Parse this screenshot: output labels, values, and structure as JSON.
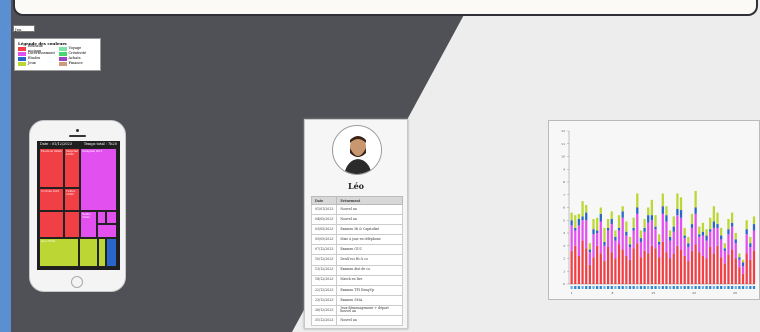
{
  "select": {
    "value": "Jeu"
  },
  "legend": {
    "title": "Légende des couleurs",
    "items": [
      {
        "label": "Réseaux sociaux",
        "color": "#f03f45"
      },
      {
        "label": "Voyage",
        "color": "#7fe2a6"
      },
      {
        "label": "Divertissement",
        "color": "#e350f0"
      },
      {
        "label": "Créativité",
        "color": "#46d66b"
      },
      {
        "label": "Etudes",
        "color": "#2a65c9"
      },
      {
        "label": "Achats",
        "color": "#9a45c9"
      },
      {
        "label": "Jeux",
        "color": "#bcd634"
      },
      {
        "label": "Finance",
        "color": "#d09a7c"
      }
    ]
  },
  "phone": {
    "date_label": "Date : 01/12/2023",
    "time_label": "Temps total : 7h20",
    "blocks": [
      "Facebook 39min",
      "Snapchat 41min",
      "Instagram 2h13",
      "YouTube 1h33",
      "Twitter 21min",
      "Netflix 31min",
      "Jeux 37min"
    ]
  },
  "profile": {
    "name": "Léo",
    "headers": {
      "date": "Date",
      "event": "Evénement"
    },
    "rows": [
      {
        "date": "01/01/2023",
        "event": "Nouvel an"
      },
      {
        "date": "04/05/2023",
        "event": "Nouvel an"
      },
      {
        "date": "03/05/2023",
        "event": "Examen Hi & Capitolisé"
      },
      {
        "date": "05/05/2023",
        "event": "Mise à jour en téléphone"
      },
      {
        "date": "07/12/2023",
        "event": "Examen GUC"
      },
      {
        "date": "10/12/2023",
        "event": "DeuX'eci Hi & co"
      },
      {
        "date": "13/12/2023",
        "event": "Examen dist de co"
      },
      {
        "date": "18/12/2023",
        "event": "Match en live"
      },
      {
        "date": "22/12/2023",
        "event": "Examen TPI DirayVp"
      },
      {
        "date": "23/12/2023",
        "event": "Examen SMA"
      },
      {
        "date": "28/12/2023",
        "event": "Jeux démenagement + départ nouvel an"
      },
      {
        "date": "31/12/2023",
        "event": "Nouvel an"
      }
    ]
  },
  "chart_data": {
    "type": "bar",
    "stacked": true,
    "ylim": [
      0,
      12
    ],
    "yticks": [
      "0",
      "1",
      "2",
      "3",
      "4",
      "5",
      "6",
      "7",
      "8",
      "9",
      "10",
      "11",
      "12"
    ],
    "xticks": [
      "1",
      "8",
      "15",
      "22",
      "29"
    ],
    "series": [
      {
        "color": "#f03f45",
        "values": [
          2.6,
          3.0,
          2.2,
          3.4,
          2.8,
          1.5,
          2.1,
          3.0,
          2.4,
          1.8,
          2.9,
          2.5,
          2.0,
          3.1,
          2.7,
          2.2,
          1.9,
          2.8,
          3.2,
          2.1,
          2.6,
          2.4,
          3.0,
          2.8,
          2.1,
          3.3,
          2.5,
          2.0,
          2.4,
          3.0,
          2.7,
          2.2,
          1.8,
          2.6,
          3.1,
          2.5,
          2.2,
          2.0,
          2.9,
          2.4,
          3.0,
          2.1,
          1.6,
          2.3,
          2.7,
          2.0,
          1.3,
          0.8,
          2.4,
          1.9,
          2.6
        ]
      },
      {
        "color": "#e350f0",
        "values": [
          2.0,
          1.2,
          2.4,
          1.6,
          2.2,
          1.0,
          1.8,
          1.0,
          2.5,
          1.2,
          1.3,
          2.2,
          1.4,
          1.1,
          2.5,
          1.6,
          1.0,
          1.4,
          2.3,
          1.2,
          1.5,
          2.4,
          2.0,
          1.5,
          1.0,
          2.2,
          2.4,
          1.4,
          1.7,
          2.4,
          2.5,
          1.4,
          1.1,
          1.8,
          2.4,
          1.2,
          1.6,
          1.4,
          1.2,
          2.0,
          1.4,
          1.4,
          1.0,
          1.6,
          1.8,
          1.2,
          0.6,
          0.6,
          1.5,
          1.0,
          1.6
        ]
      },
      {
        "color": "#2a65c9",
        "values": [
          0.4,
          0.2,
          0.5,
          0.3,
          0.6,
          0.2,
          0.4,
          0.2,
          0.6,
          0.3,
          0.2,
          0.4,
          0.3,
          0.2,
          0.5,
          0.3,
          0.2,
          0.2,
          0.5,
          0.3,
          0.3,
          0.6,
          0.4,
          0.2,
          0.2,
          0.6,
          0.5,
          0.3,
          0.4,
          0.5,
          0.6,
          0.2,
          0.3,
          0.3,
          0.5,
          0.2,
          0.3,
          0.4,
          0.2,
          0.5,
          0.3,
          0.3,
          0.2,
          0.4,
          0.3,
          0.3,
          0.2,
          0.3,
          0.4,
          0.3,
          0.5
        ]
      },
      {
        "color": "#bcd634",
        "values": [
          0.6,
          1.0,
          0.4,
          1.2,
          0.6,
          0.5,
          0.8,
          1.0,
          0.5,
          1.1,
          0.7,
          0.6,
          0.5,
          1.0,
          0.4,
          0.8,
          0.6,
          0.8,
          1.1,
          0.6,
          0.7,
          0.6,
          1.2,
          0.9,
          0.6,
          1.0,
          0.7,
          0.5,
          0.8,
          1.2,
          1.0,
          0.6,
          0.5,
          0.8,
          1.3,
          0.6,
          0.7,
          0.5,
          0.9,
          1.2,
          0.9,
          0.6,
          0.4,
          0.8,
          0.8,
          0.5,
          0.3,
          0.2,
          0.7,
          0.5,
          0.6
        ]
      }
    ]
  }
}
